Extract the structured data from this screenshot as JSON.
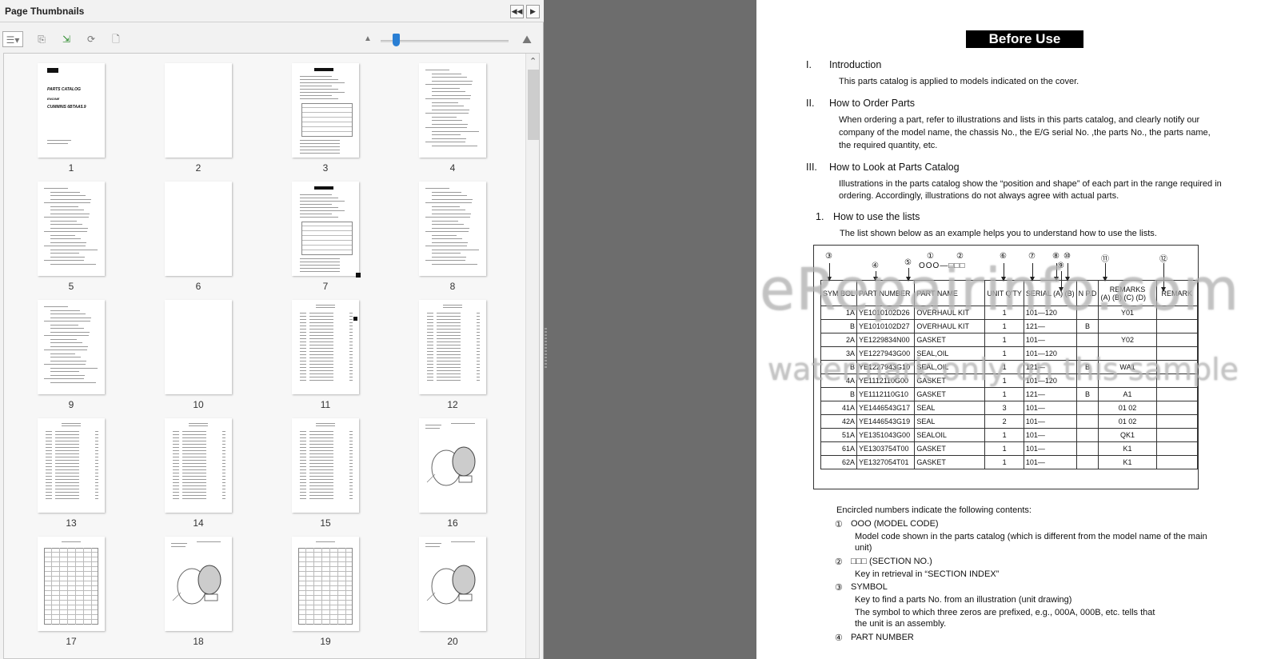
{
  "panel": {
    "title": "Page Thumbnails",
    "btn_collapse": "◀◀",
    "btn_next": "▶"
  },
  "toolbar": {
    "options_icon": "thumbnail-options-icon",
    "zoom_level": 0.1
  },
  "thumbnails": [
    {
      "num": "1",
      "kind": "cover",
      "title": "PARTS CATALOG",
      "sub": "ENGINE",
      "model": "CUMMINS 6BTAA5.9"
    },
    {
      "num": "2",
      "kind": "blank"
    },
    {
      "num": "3",
      "kind": "text-table"
    },
    {
      "num": "4",
      "kind": "text"
    },
    {
      "num": "5",
      "kind": "text"
    },
    {
      "num": "6",
      "kind": "blank"
    },
    {
      "num": "7",
      "kind": "text-table"
    },
    {
      "num": "8",
      "kind": "text"
    },
    {
      "num": "9",
      "kind": "text"
    },
    {
      "num": "10",
      "kind": "blank"
    },
    {
      "num": "11",
      "kind": "list"
    },
    {
      "num": "12",
      "kind": "list"
    },
    {
      "num": "13",
      "kind": "list"
    },
    {
      "num": "14",
      "kind": "list"
    },
    {
      "num": "15",
      "kind": "list"
    },
    {
      "num": "16",
      "kind": "drawing"
    },
    {
      "num": "17",
      "kind": "grid"
    },
    {
      "num": "18",
      "kind": "drawing"
    },
    {
      "num": "19",
      "kind": "grid"
    },
    {
      "num": "20",
      "kind": "drawing"
    }
  ],
  "document": {
    "title": "Before Use",
    "sections": [
      {
        "num": "I.",
        "heading": "Introduction",
        "lines": [
          "This parts catalog is applied to models indicated on the cover."
        ]
      },
      {
        "num": "II.",
        "heading": "How to Order Parts",
        "lines": [
          "When ordering a part, refer to illustrations and lists in this parts catalog, and clearly notify our",
          "company of the model name, the chassis No., the E/G serial No. ,the parts No., the parts name,",
          "the required quantity, etc."
        ]
      },
      {
        "num": "III.",
        "heading": "How to Look at Parts Catalog",
        "lines": [
          "Illustrations in the parts catalog show the “position and shape” of each part in the range required in",
          "ordering.    Accordingly, illustrations do not always agree with actual parts."
        ]
      }
    ],
    "subsection": {
      "num": "1.",
      "heading": "How to use the lists",
      "line": "The list shown below as an example helps you to understand how to use the lists."
    },
    "example": {
      "code_label": "OOO—□□□",
      "circled": [
        "①",
        "②",
        "③",
        "④",
        "⑤",
        "⑥",
        "⑦",
        "⑧",
        "⑨",
        "⑩",
        "⑪",
        "⑫"
      ],
      "headers": {
        "sym": "SYM BOL",
        "part_number": "PART NUMBER",
        "part_name": "PART NAME",
        "unit_qty": "UNIT Q'TY",
        "serial": "SERIAL (A) (B)",
        "npd": "N P.D",
        "remarks": "REMARKS",
        "remarks_sub": "(A)  (B)  (C)  (D)",
        "remark": "REMARK"
      },
      "rows": [
        {
          "sym": "1A",
          "pn": "YE1010102D26",
          "name": "OVERHAUL KIT",
          "qty": "1",
          "serial": "101—120",
          "npd": "",
          "rem": "Y01",
          "remark": ""
        },
        {
          "sym": "B",
          "pn": "YE1010102D27",
          "name": "OVERHAUL KIT",
          "qty": "1",
          "serial": "121—",
          "npd": "B",
          "rem": "",
          "remark": ""
        },
        {
          "sym": "2A",
          "pn": "YE1229834N00",
          "name": "GASKET",
          "qty": "1",
          "serial": "101—",
          "npd": "",
          "rem": "Y02",
          "remark": ""
        },
        {
          "sym": "3A",
          "pn": "YE1227943G00",
          "name": "SEAL,OIL",
          "qty": "1",
          "serial": "101—120",
          "npd": "",
          "rem": "",
          "remark": ""
        },
        {
          "sym": "B",
          "pn": "YE1227943G10",
          "name": "SEAL,OIL",
          "qty": "1",
          "serial": "121—",
          "npd": "B",
          "rem": "WA1",
          "remark": ""
        },
        {
          "sym": "4A",
          "pn": "YE1112110G00",
          "name": "GASKET",
          "qty": "1",
          "serial": "101—120",
          "npd": "",
          "rem": "",
          "remark": ""
        },
        {
          "sym": "B",
          "pn": "YE1112110G10",
          "name": "GASKET",
          "qty": "1",
          "serial": "121—",
          "npd": "B",
          "rem": "A1",
          "remark": ""
        },
        {
          "sym": "41A",
          "pn": "YE1446543G17",
          "name": "SEAL",
          "qty": "3",
          "serial": "101—",
          "npd": "",
          "rem": "01  02",
          "remark": ""
        },
        {
          "sym": "42A",
          "pn": "YE1446543G19",
          "name": "SEAL",
          "qty": "2",
          "serial": "101—",
          "npd": "",
          "rem": "01  02",
          "remark": ""
        },
        {
          "sym": "51A",
          "pn": "YE1351043G00",
          "name": "SEALOIL",
          "qty": "1",
          "serial": "101—",
          "npd": "",
          "rem": "QK1",
          "remark": ""
        },
        {
          "sym": "61A",
          "pn": "YE1303754T00",
          "name": "GASKET",
          "qty": "1",
          "serial": "101—",
          "npd": "",
          "rem": "K1",
          "remark": ""
        },
        {
          "sym": "62A",
          "pn": "YE1327054T01",
          "name": "GASKET",
          "qty": "1",
          "serial": "101—",
          "npd": "",
          "rem": "K1",
          "remark": ""
        }
      ]
    },
    "encircled_intro": "Encircled numbers indicate the following contents:",
    "notes": [
      {
        "mark": "①",
        "title": "OOO (MODEL CODE)",
        "lines": [
          "Model code shown in the parts catalog (which is different from the model name of the main",
          "unit)"
        ]
      },
      {
        "mark": "②",
        "title": "□□□ (SECTION NO.)",
        "lines": [
          "Key in retrieval in “SECTION INDEX”"
        ]
      },
      {
        "mark": "③",
        "title": "SYMBOL",
        "lines": [
          "Key to find a parts No. from an illustration (unit drawing)",
          "The symbol to which three zeros are prefixed, e.g., 000A, 000B, etc. tells that",
          "the unit is an assembly."
        ]
      },
      {
        "mark": "④",
        "title": "PART NUMBER",
        "lines": []
      }
    ]
  },
  "watermark": {
    "line1": "eRepairinfo.com",
    "line2": "watermark only on this sample"
  }
}
